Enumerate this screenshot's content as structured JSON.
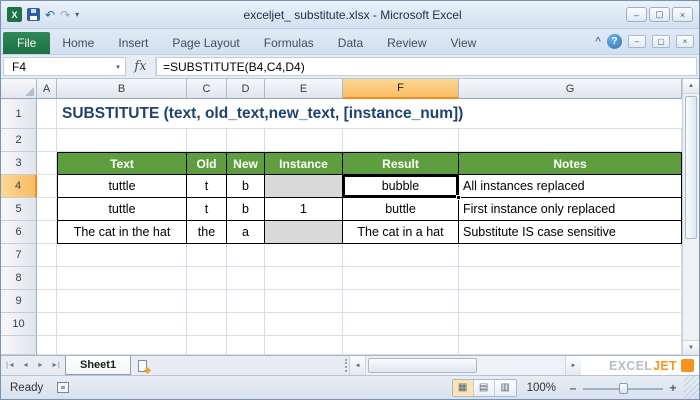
{
  "titlebar": {
    "title": "exceljet_ substitute.xlsx - Microsoft Excel"
  },
  "ribbon_tabs": [
    "File",
    "Home",
    "Insert",
    "Page Layout",
    "Formulas",
    "Data",
    "Review",
    "View"
  ],
  "formula_bar": {
    "name_box": "F4",
    "fx_label": "fx",
    "formula": "=SUBSTITUTE(B4,C4,D4)"
  },
  "grid": {
    "columns": [
      "A",
      "B",
      "C",
      "D",
      "E",
      "F",
      "G"
    ],
    "rows": [
      "1",
      "2",
      "3",
      "4",
      "5",
      "6",
      "7",
      "8",
      "9",
      "10"
    ],
    "selection": {
      "active_cell": "F4",
      "selected_column": "F",
      "selected_row": "4"
    }
  },
  "cells": {
    "title": "SUBSTITUTE (text, old_text,new_text, [instance_num])",
    "header": {
      "text": "Text",
      "old": "Old",
      "new": "New",
      "instance": "Instance",
      "result": "Result",
      "notes": "Notes"
    },
    "row4": {
      "text": "tuttle",
      "old": "t",
      "new": "b",
      "instance": "",
      "result": "bubble",
      "notes": "All instances replaced"
    },
    "row5": {
      "text": "tuttle",
      "old": "t",
      "new": "b",
      "instance": "1",
      "result": "buttle",
      "notes": "First instance only replaced"
    },
    "row6": {
      "text": "The cat in the hat",
      "old": "the",
      "new": "a",
      "instance": "",
      "result": "The cat in a hat",
      "notes": "Substitute IS case sensitive"
    }
  },
  "sheet_bar": {
    "tab": "Sheet1"
  },
  "status_bar": {
    "mode": "Ready",
    "zoom": "100%"
  },
  "logo": {
    "excel": "EXCEL",
    "jet": "JET"
  },
  "icons": {
    "app": "X",
    "undo": "↶",
    "redo": "↷",
    "caret_down": "▾",
    "chevron_up": "^",
    "help": "?",
    "minimize": "–",
    "maximize": "▢",
    "close": "×",
    "nav_first": "|◄",
    "nav_prev": "◄",
    "nav_next": "►",
    "nav_last": "►|",
    "scroll_left": "◄",
    "scroll_right": "►",
    "scroll_up": "▲",
    "scroll_down": "▼",
    "view_normal": "▦",
    "view_page_layout": "▤",
    "view_page_break": "▥",
    "zoom_out": "–",
    "zoom_in": "+"
  },
  "colors": {
    "file_tab_green": "#1E7145",
    "table_header_green": "#5F9E3E",
    "title_text_blue": "#1F4273",
    "selection_highlight_orange": "#F9BC62",
    "selection_border_orange": "#EF8D18",
    "gray_cell_fill": "#D9D9D9",
    "logo_orange": "#F7941E"
  }
}
